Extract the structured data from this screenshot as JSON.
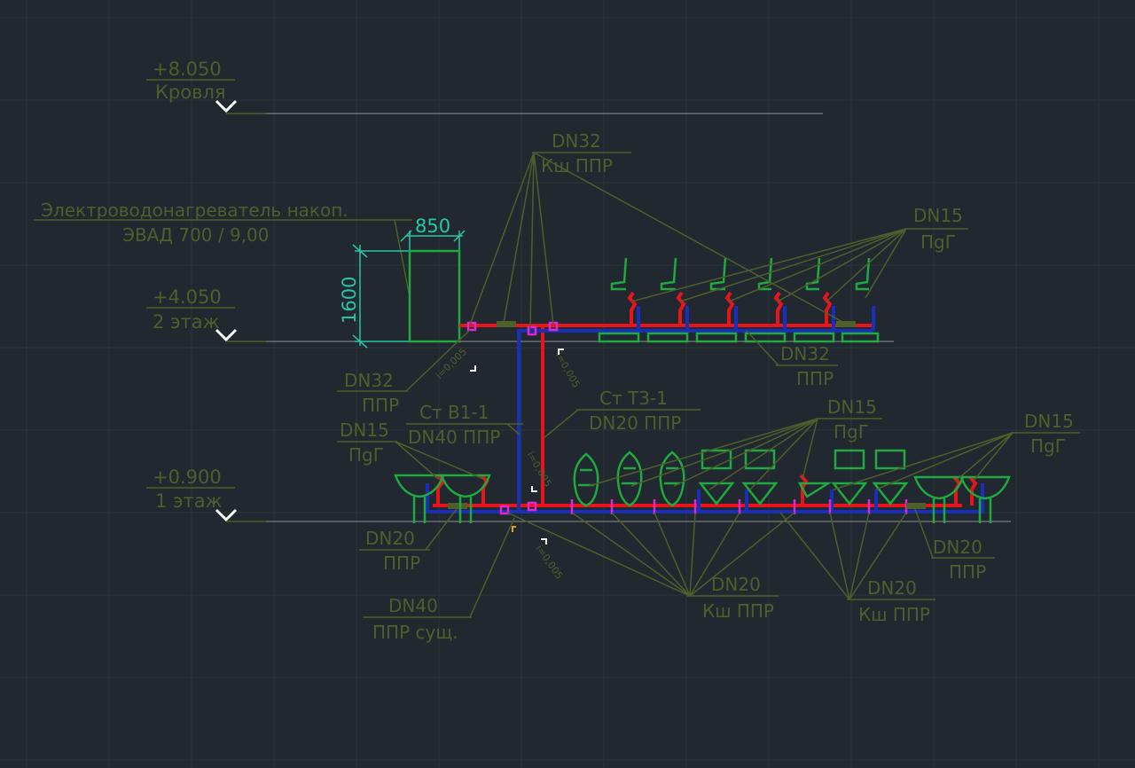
{
  "colors": {
    "background": "#212830",
    "grid": "#2b333c",
    "annotation": "#4e5f2b",
    "dimension": "#27c7a4",
    "fixture": "#1faa3f",
    "hot_pipe": "#e8141c",
    "cold_pipe": "#1a2fb8",
    "fitting": "#e028d0",
    "level_line": "#8a9099",
    "marker": "#ffffff"
  },
  "levels": {
    "roof": {
      "elevation": "+8.050",
      "name": "Кровля"
    },
    "floor2": {
      "elevation": "+4.050",
      "name": "2 этаж"
    },
    "floor1": {
      "elevation": "+0.900",
      "name": "1 этаж"
    }
  },
  "heater": {
    "label_line1": "Электроводонагреватель накоп.",
    "label_line2": "ЭВАД 700 / 9,00",
    "width_dim": "850",
    "height_dim": "1600"
  },
  "callouts": {
    "riser_top": {
      "line1": "DN32",
      "line2": "Кш ППР"
    },
    "floor2_fixtures": {
      "line1": "DN15",
      "line2": "ПgГ"
    },
    "floor2_main": {
      "line1": "DN32",
      "line2": "ППР"
    },
    "heater_feed": {
      "line1": "DN32",
      "line2": "ППР"
    },
    "riser_cold": {
      "line1": "Ст В1-1",
      "line2": "DN40 ППР"
    },
    "riser_hot": {
      "line1": "Ст Т3-1",
      "line2": "DN20 ППР"
    },
    "floor1_left_fixtures": {
      "line1": "DN15",
      "line2": "ПgГ"
    },
    "floor1_mid_fixtures": {
      "line1": "DN15",
      "line2": "ПgГ"
    },
    "floor1_right_fixtures": {
      "line1": "DN15",
      "line2": "ПgГ"
    },
    "floor1_left_pipe": {
      "line1": "DN20",
      "line2": "ППР"
    },
    "floor1_right_pipe": {
      "line1": "DN20",
      "line2": "ППР"
    },
    "existing": {
      "line1": "DN40",
      "line2": "ППР сущ."
    },
    "valves_mid": {
      "line1": "DN20",
      "line2": "Кш ППР"
    },
    "valves_right": {
      "line1": "DN20",
      "line2": "Кш ППР"
    }
  },
  "slopes": {
    "s1": "i=0,005",
    "s2": "i=0,005",
    "s3": "i=0,005",
    "s4": "i=0,005"
  }
}
